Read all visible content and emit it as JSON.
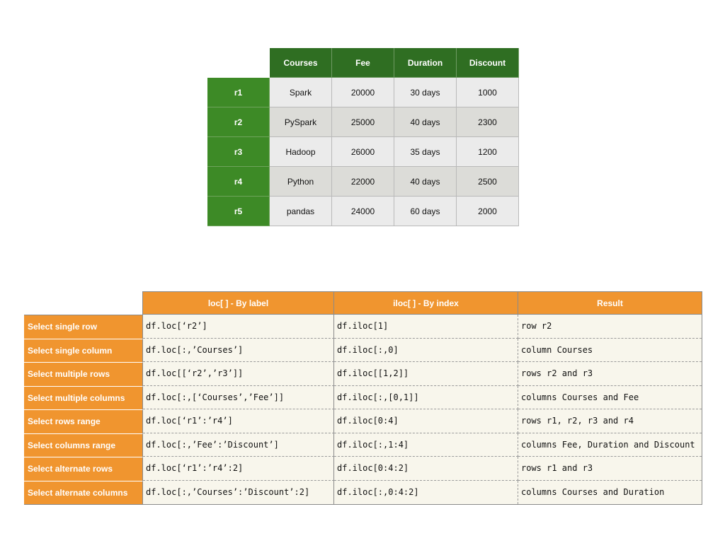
{
  "dataframe": {
    "columns": [
      "Courses",
      "Fee",
      "Duration",
      "Discount"
    ],
    "rows": [
      {
        "index": "r1",
        "values": [
          "Spark",
          "20000",
          "30 days",
          "1000"
        ]
      },
      {
        "index": "r2",
        "values": [
          "PySpark",
          "25000",
          "40 days",
          "2300"
        ]
      },
      {
        "index": "r3",
        "values": [
          "Hadoop",
          "26000",
          "35 days",
          "1200"
        ]
      },
      {
        "index": "r4",
        "values": [
          "Python",
          "22000",
          "40 days",
          "2500"
        ]
      },
      {
        "index": "r5",
        "values": [
          "pandas",
          "24000",
          "60 days",
          "2000"
        ]
      }
    ],
    "colors": {
      "header": "#2f6e22",
      "index": "#3d8a26"
    }
  },
  "reference": {
    "headers": [
      "loc[ ] - By label",
      "iloc[ ] - By index",
      "Result"
    ],
    "rows": [
      {
        "label": "Select single row",
        "loc": "df.loc[‘r2’]",
        "iloc": "df.iloc[1]",
        "result": "row r2"
      },
      {
        "label": "Select single column",
        "loc": "df.loc[:,’Courses’]",
        "iloc": "df.iloc[:,0]",
        "result": "column Courses"
      },
      {
        "label": "Select multiple rows",
        "loc": "df.loc[[‘r2’,’r3’]]",
        "iloc": "df.iloc[[1,2]]",
        "result": "rows r2 and r3"
      },
      {
        "label": "Select multiple columns",
        "loc": "df.loc[:,[‘Courses’,’Fee’]]",
        "iloc": "df.iloc[:,[0,1]]",
        "result": "columns Courses and Fee"
      },
      {
        "label": "Select rows range",
        "loc": "df.loc[‘r1’:’r4’]",
        "iloc": "df.iloc[0:4]",
        "result": "rows r1, r2, r3 and r4"
      },
      {
        "label": "Select columns range",
        "loc": "df.loc[:,’Fee’:’Discount’]",
        "iloc": "df.iloc[:,1:4]",
        "result": "columns Fee, Duration and Discount"
      },
      {
        "label": "Select alternate rows",
        "loc": "df.loc[‘r1’:’r4’:2]",
        "iloc": "df.iloc[0:4:2]",
        "result": "rows r1 and r3"
      },
      {
        "label": "Select alternate columns",
        "loc": "df.loc[:,’Courses’:’Discount’:2]",
        "iloc": "df.iloc[:,0:4:2]",
        "result": "columns Courses and Duration"
      }
    ],
    "colors": {
      "header": "#f0952f",
      "cell": "#f8f6ec"
    }
  }
}
